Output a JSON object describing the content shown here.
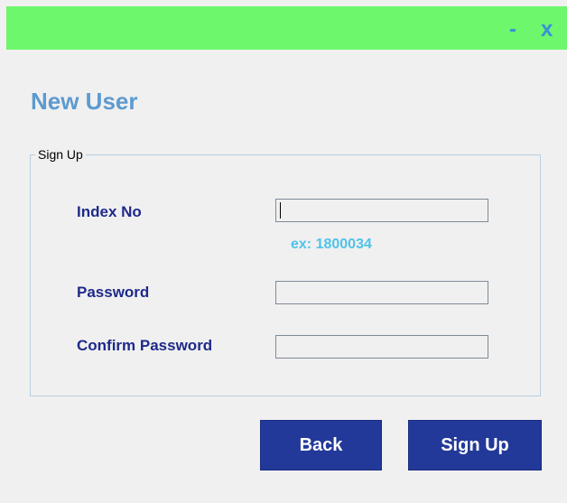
{
  "titlebar": {
    "minimize_label": "-",
    "close_label": "x",
    "background": "#6cf76c",
    "button_color": "#3a8fd9"
  },
  "heading": "New User",
  "signup_group": {
    "legend": "Sign Up",
    "fields": {
      "index_no": {
        "label": "Index No",
        "value": "",
        "hint": "ex: 1800034"
      },
      "password": {
        "label": "Password",
        "value": ""
      },
      "confirm_password": {
        "label": "Confirm Password",
        "value": ""
      }
    }
  },
  "buttons": {
    "back": "Back",
    "sign_up": "Sign Up",
    "color": "#23399a"
  }
}
